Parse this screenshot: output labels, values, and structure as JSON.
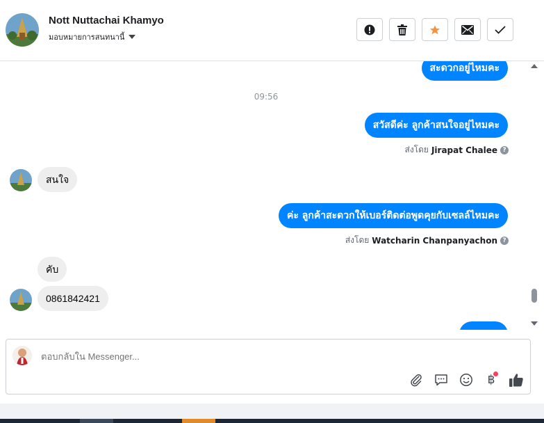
{
  "header": {
    "name": "Nott Nuttachai Khamyo",
    "subtitle": "มอบหมายการสนทนานี้",
    "actions": [
      {
        "icon": "alert-icon",
        "label": "spam"
      },
      {
        "icon": "trash-icon",
        "label": "delete"
      },
      {
        "icon": "star-icon",
        "label": "star",
        "color": "#f7923a"
      },
      {
        "icon": "mail-icon",
        "label": "mark-unread"
      },
      {
        "icon": "check-icon",
        "label": "done"
      }
    ]
  },
  "messages": {
    "m1": "สะดวกอยู่ไหมคะ",
    "time": "09:56",
    "m2": "สวัสดีค่ะ ลูกค้าสนใจอยู่ไหมคะ",
    "sent1_prefix": "ส่งโดย",
    "sent1_name": "Jirapat Chalee",
    "m3": "สนใจ",
    "m4": "ค่ะ ลูกค้าสะดวกให้เบอร์ติดต่อพูดคุยกับเซลล์ไหมคะ",
    "sent2_prefix": "ส่งโดย",
    "sent2_name": "Watcharin Chanpanyachon",
    "m5": "คับ",
    "m6": "0861842421"
  },
  "composer": {
    "placeholder": "ตอบกลับใน Messenger...",
    "tools": [
      "paperclip-icon",
      "chat-icon",
      "emoji-icon",
      "baht-icon",
      "like-icon"
    ]
  },
  "colors": {
    "accent": "#0084ff",
    "incoming": "#eeeeef",
    "star": "#f7923a",
    "badge": "#fa3e5e"
  }
}
